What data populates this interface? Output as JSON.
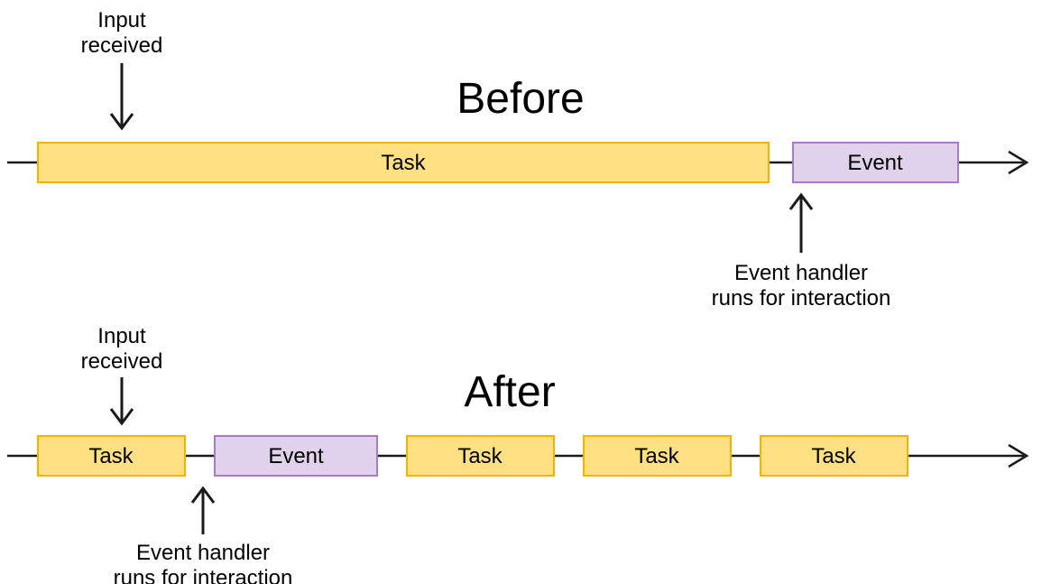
{
  "before": {
    "title": "Before",
    "annot_input_l1": "Input",
    "annot_input_l2": "received",
    "annot_handler_l1": "Event handler",
    "annot_handler_l2": "runs for interaction",
    "blocks": {
      "task_long": "Task",
      "event": "Event"
    }
  },
  "after": {
    "title": "After",
    "annot_input_l1": "Input",
    "annot_input_l2": "received",
    "annot_handler_l1": "Event handler",
    "annot_handler_l2": "runs for interaction",
    "blocks": {
      "t1": "Task",
      "event": "Event",
      "t2": "Task",
      "t3": "Task",
      "t4": "Task"
    }
  },
  "colors": {
    "task_fill": "#FFE082",
    "task_stroke": "#F5B301",
    "event_fill": "#E1D2EC",
    "event_stroke": "#A97BC7",
    "line": "#1a1a1a"
  }
}
